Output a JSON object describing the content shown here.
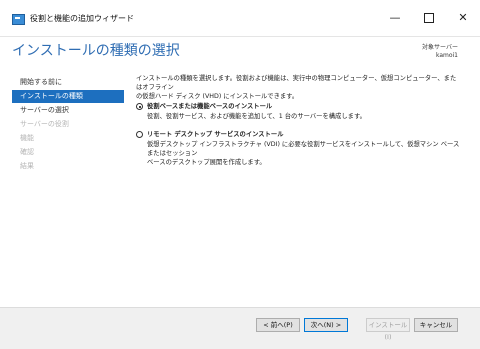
{
  "window": {
    "title": "役割と機能の追加ウィザード",
    "minimize": "—",
    "close": "✕"
  },
  "header": {
    "page_title": "インストールの種類の選択",
    "target_label": "対象サーバー",
    "target_server": "kamoi1"
  },
  "nav": {
    "items": [
      {
        "label": "開始する前に",
        "state": "normal"
      },
      {
        "label": "インストールの種類",
        "state": "active"
      },
      {
        "label": "サーバーの選択",
        "state": "normal"
      },
      {
        "label": "サーバーの役割",
        "state": "disabled"
      },
      {
        "label": "機能",
        "state": "disabled"
      },
      {
        "label": "確認",
        "state": "disabled"
      },
      {
        "label": "結果",
        "state": "disabled"
      }
    ]
  },
  "content": {
    "description_line1": "インストールの種類を選択します。役割および機能は、実行中の物理コンピューター、仮想コンピューター、またはオフライン",
    "description_line2": "の仮想ハード ディスク (VHD) にインストールできます。",
    "options": [
      {
        "title": "役割ベースまたは機能ベースのインストール",
        "desc_line1": "役割、役割サービス、および機能を追加して、1 台のサーバーを構成します。",
        "desc_line2": "",
        "selected": true
      },
      {
        "title": "リモート デスクトップ サービスのインストール",
        "desc_line1": "仮想デスクトップ インフラストラクチャ (VDI) に必要な役割サービスをインストールして、仮想マシン ベースまたはセッション",
        "desc_line2": "ベースのデスクトップ展開を作成します。",
        "selected": false
      }
    ]
  },
  "footer": {
    "back": "< 前へ(P)",
    "next": "次へ(N) >",
    "install": "インストール(I)",
    "cancel": "キャンセル"
  }
}
